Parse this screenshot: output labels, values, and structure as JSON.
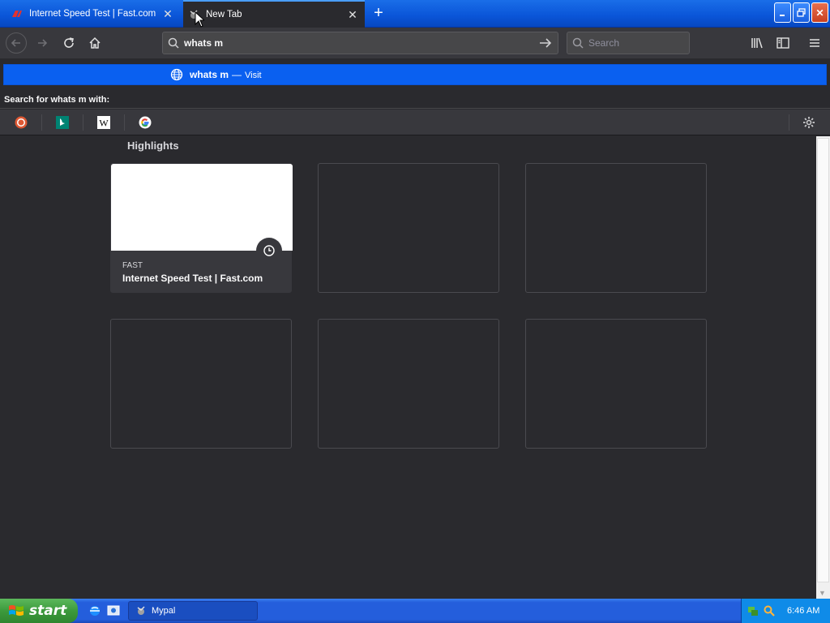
{
  "browser": {
    "tabs": [
      {
        "title": "Internet Speed Test | Fast.com",
        "active": false,
        "favicon": "fast-favicon"
      },
      {
        "title": "New Tab",
        "active": true,
        "favicon": "mypal-favicon"
      }
    ],
    "new_tab_icon": "plus-icon",
    "window_controls": [
      "minimize-icon",
      "restore-icon",
      "close-icon"
    ]
  },
  "toolbar": {
    "url_value": "whats m",
    "search_placeholder": "Search",
    "buttons": [
      "back-icon",
      "forward-icon",
      "reload-icon",
      "home-icon",
      "go-arrow-icon",
      "library-icon",
      "sidebar-icon",
      "menu-icon"
    ]
  },
  "autocomplete": {
    "suggestion_text": "whats m",
    "separator": "—",
    "action": "Visit",
    "search_with_label": "Search for whats m with:",
    "engines": [
      "duckduckgo-icon",
      "bing-icon",
      "wikipedia-icon",
      "google-icon"
    ]
  },
  "content": {
    "section_title": "Highlights",
    "cards": [
      {
        "source": "FAST",
        "title": "Internet Speed Test | Fast.com",
        "filled": true
      }
    ]
  },
  "taskbar": {
    "start_label": "start",
    "task_label": "Mypal",
    "clock": "6:46 AM"
  },
  "colors": {
    "titlebar": "#0a55d8",
    "toolbar": "#38383d",
    "content_bg": "#2a2a2e",
    "suggestion_bg": "#0a60f0",
    "taskbar": "#245edc"
  }
}
